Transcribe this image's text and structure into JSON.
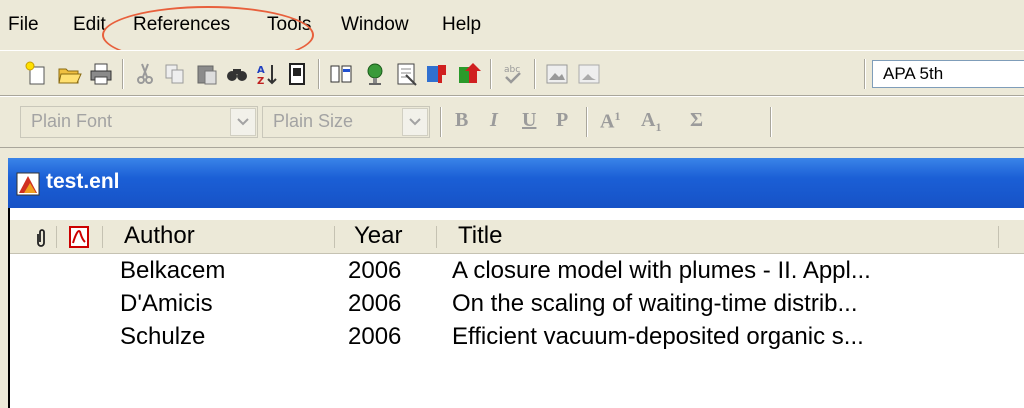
{
  "menubar": {
    "items": [
      "File",
      "Edit",
      "References",
      "Tools",
      "Window",
      "Help"
    ]
  },
  "toolbar": {
    "style_value": "APA 5th",
    "icons": [
      "new-library-icon",
      "open-library-icon",
      "print-icon",
      "cut-icon",
      "copy-icon",
      "paste-icon",
      "find-icon",
      "sort-icon",
      "copy-formatted-icon",
      "show-all-fields-icon",
      "online-search-icon",
      "find-full-text-icon",
      "insert-citation-icon",
      "format-bibliography-icon",
      "spellcheck-icon",
      "insert-picture-icon",
      "insert-object-icon"
    ]
  },
  "format_bar": {
    "font_value": "Plain Font",
    "size_value": "Plain Size",
    "bold": "B",
    "italic": "I",
    "underline": "U",
    "plain": "P",
    "superscript": "A",
    "superscript_mark": "1",
    "subscript": "A",
    "subscript_mark": "1",
    "symbol": "Σ"
  },
  "document": {
    "title": "test.enl",
    "columns": {
      "author": "Author",
      "year": "Year",
      "title": "Title"
    },
    "rows": [
      {
        "author": "Belkacem",
        "year": "2006",
        "title": "A closure model with plumes - II. Appl..."
      },
      {
        "author": "D'Amicis",
        "year": "2006",
        "title": "On the scaling of waiting-time distrib..."
      },
      {
        "author": "Schulze",
        "year": "2006",
        "title": "Efficient vacuum-deposited organic s..."
      }
    ]
  },
  "colors": {
    "titlebar": "#1652c6",
    "annotation": "#e8603c",
    "chrome": "#ece9d8"
  }
}
